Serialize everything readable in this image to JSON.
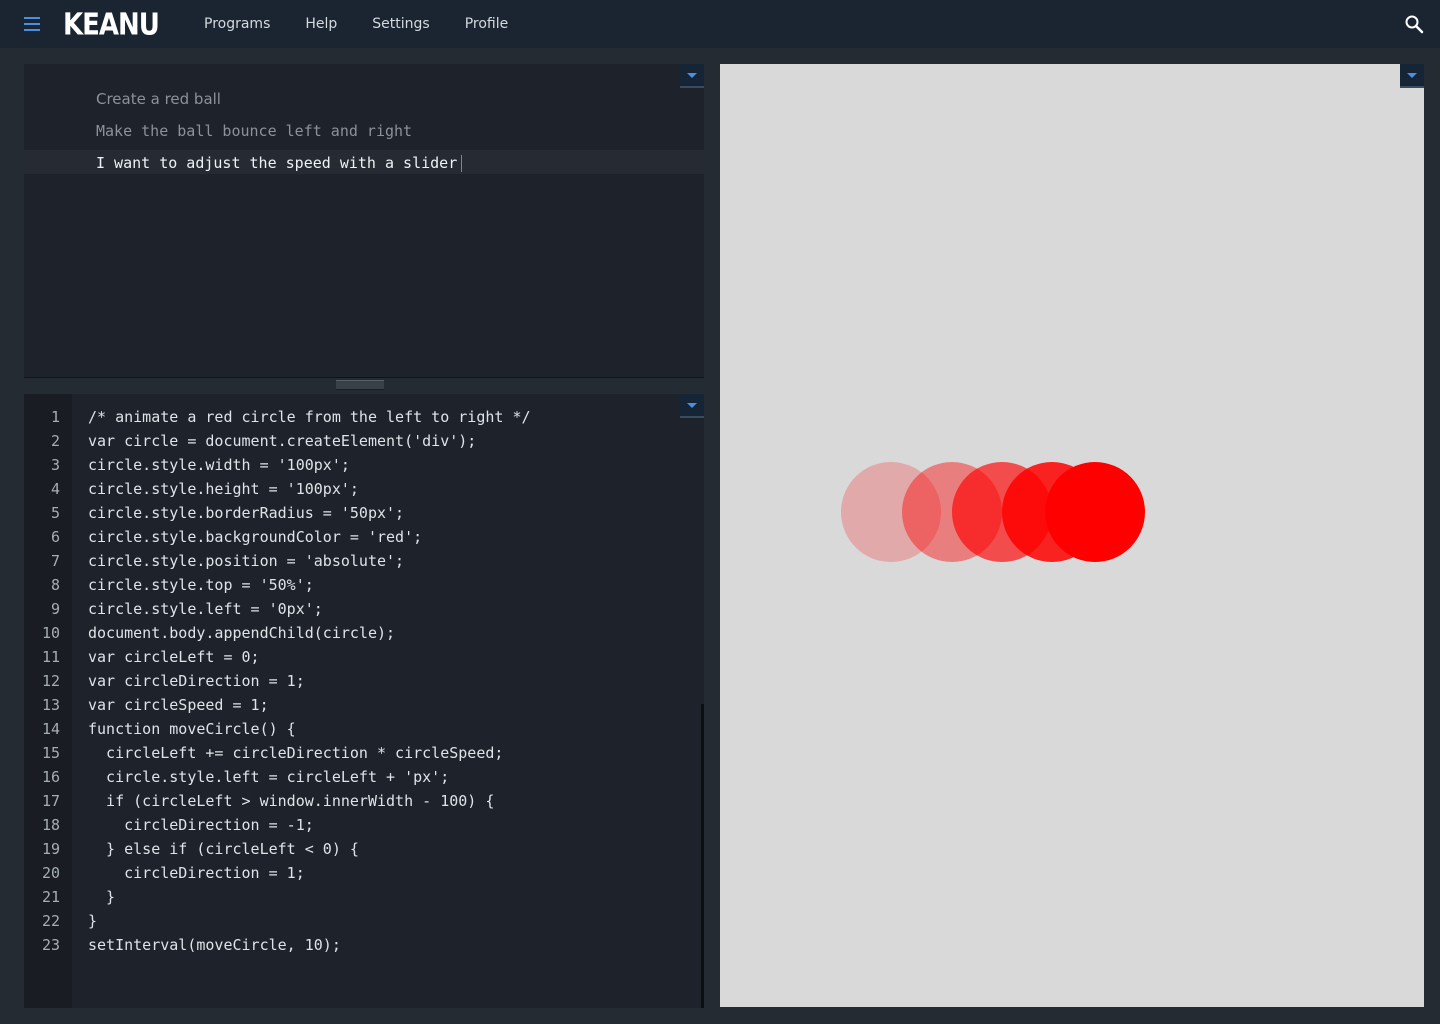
{
  "app": {
    "logo": "KEANU"
  },
  "nav": {
    "items": [
      {
        "label": "Programs"
      },
      {
        "label": "Help"
      },
      {
        "label": "Settings"
      },
      {
        "label": "Profile"
      }
    ]
  },
  "icons": {
    "menu": "menu-icon",
    "search": "search-icon",
    "panel_toggle": "chevron-down-icon"
  },
  "prompts": {
    "lines": [
      "Create a red ball",
      "Make the ball bounce left and right",
      "I want to adjust the speed with a slider"
    ]
  },
  "code": {
    "lines": [
      {
        "n": "1",
        "text": "/* animate a red circle from the left to right */"
      },
      {
        "n": "2",
        "text": "var circle = document.createElement('div');"
      },
      {
        "n": "3",
        "text": "circle.style.width = '100px';"
      },
      {
        "n": "4",
        "text": "circle.style.height = '100px';"
      },
      {
        "n": "5",
        "text": "circle.style.borderRadius = '50px';"
      },
      {
        "n": "6",
        "text": "circle.style.backgroundColor = 'red';"
      },
      {
        "n": "7",
        "text": "circle.style.position = 'absolute';"
      },
      {
        "n": "8",
        "text": "circle.style.top = '50%';"
      },
      {
        "n": "9",
        "text": "circle.style.left = '0px';"
      },
      {
        "n": "10",
        "text": "document.body.appendChild(circle);"
      },
      {
        "n": "11",
        "text": "var circleLeft = 0;"
      },
      {
        "n": "12",
        "text": "var circleDirection = 1;"
      },
      {
        "n": "13",
        "text": "var circleSpeed = 1;"
      },
      {
        "n": "14",
        "text": "function moveCircle() {"
      },
      {
        "n": "15",
        "text": "  circleLeft += circleDirection * circleSpeed;"
      },
      {
        "n": "16",
        "text": "  circle.style.left = circleLeft + 'px';"
      },
      {
        "n": "17",
        "text": "  if (circleLeft > window.innerWidth - 100) {"
      },
      {
        "n": "18",
        "text": "    circleDirection = -1;"
      },
      {
        "n": "19",
        "text": "  } else if (circleLeft < 0) {"
      },
      {
        "n": "20",
        "text": "    circleDirection = 1;"
      },
      {
        "n": "21",
        "text": "  }"
      },
      {
        "n": "22",
        "text": "}"
      },
      {
        "n": "23",
        "text": "setInterval(moveCircle, 10);"
      }
    ]
  },
  "preview": {
    "background": "#d9d9d9",
    "ball_color": "#ff0000",
    "ball_opacities": [
      0.22,
      0.42,
      0.65,
      0.85,
      1.0
    ]
  },
  "colors": {
    "accent": "#4a90e2",
    "topbar": "#1a2531",
    "editor_bg": "#1e222a"
  }
}
